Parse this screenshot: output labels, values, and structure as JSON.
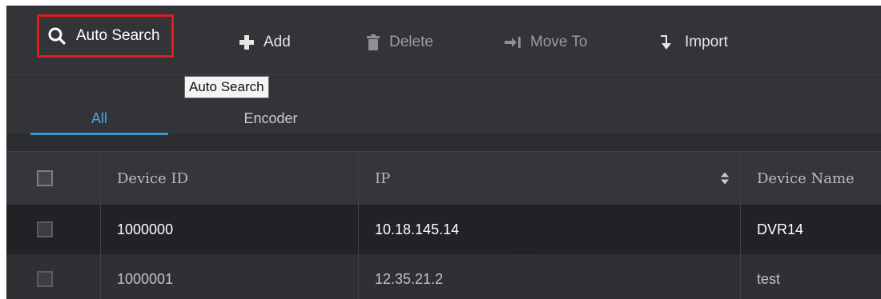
{
  "toolbar": {
    "auto_search": "Auto Search",
    "add": "Add",
    "delete": "Delete",
    "move_to": "Move To",
    "import": "Import"
  },
  "tooltip": "Auto Search",
  "tabs": [
    {
      "label": "All",
      "active": true
    },
    {
      "label": "Encoder",
      "active": false
    }
  ],
  "table": {
    "columns": [
      "Device ID",
      "IP",
      "Device Name"
    ],
    "rows": [
      {
        "device_id": "1000000",
        "ip": "10.18.145.14",
        "device_name": "DVR14",
        "selected": true
      },
      {
        "device_id": "1000001",
        "ip": "12.35.21.2",
        "device_name": "test",
        "selected": false
      }
    ]
  },
  "colors": {
    "highlight": "#e01c1c",
    "accent": "#3a95d6",
    "background": "#2f3136"
  }
}
